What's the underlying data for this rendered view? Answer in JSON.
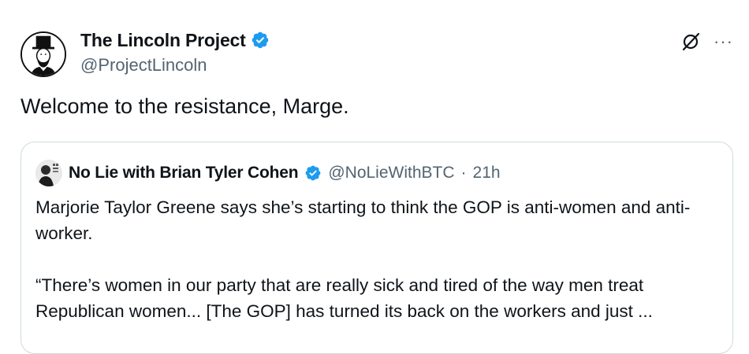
{
  "tweet": {
    "author_name": "The Lincoln Project",
    "author_handle": "@ProjectLincoln",
    "text": "Welcome to the resistance, Marge.",
    "more_label": "···"
  },
  "quote": {
    "author_name": "No Lie with Brian Tyler Cohen",
    "author_handle": "@NoLieWithBTC",
    "separator": "·",
    "time": "21h",
    "paragraph_1": "Marjorie Taylor Greene says she’s starting to think the GOP is anti-women and anti-worker.",
    "paragraph_2": "“There’s women in our party that are really sick and tired of the way men treat Republican women...  [The GOP] has turned its back on the workers and just ..."
  },
  "colors": {
    "verified_blue": "#1d9bf0",
    "secondary_text": "#536471",
    "border": "#cfd9de"
  }
}
